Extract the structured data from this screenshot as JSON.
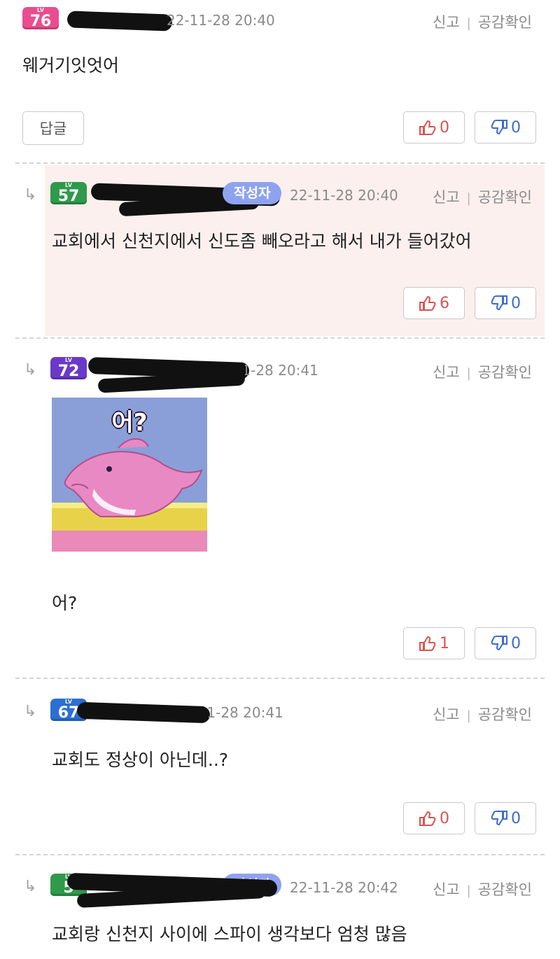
{
  "comments": [
    {
      "level": "76",
      "date": "22-11-28 20:40",
      "report_label": "신고",
      "check_label": "공감확인",
      "text": "웨거기잇엇어",
      "reply_label": "답글",
      "likes": "0",
      "dislikes": "0",
      "badge_color": "#ea4d8f"
    },
    {
      "level": "57",
      "author_tag": "작성자",
      "date": "22-11-28 20:40",
      "report_label": "신고",
      "check_label": "공감확인",
      "text": "교회에서 신천지에서 신도좀 빼오라고 해서 내가 들어갔어",
      "likes": "6",
      "dislikes": "0",
      "badge_color": "#2f9a4a"
    },
    {
      "level": "72",
      "date": "22-11-28 20:41",
      "report_label": "신고",
      "check_label": "공감확인",
      "sticker_text": "어?",
      "text": "어?",
      "likes": "1",
      "dislikes": "0",
      "badge_color": "#6a39c9"
    },
    {
      "level": "67",
      "date": "22-11-28 20:41",
      "report_label": "신고",
      "check_label": "공감확인",
      "text": "교회도 정상이 아닌데..?",
      "likes": "0",
      "dislikes": "0",
      "badge_color": "#2b6fd1"
    },
    {
      "level": "5",
      "author_tag": "작성자",
      "date": "22-11-28 20:42",
      "report_label": "신고",
      "check_label": "공감확인",
      "text": "교회랑 신천지 사이에 스파이 생각보다 엄청 많음",
      "badge_color": "#2f9a4a"
    }
  ],
  "icons": {
    "reply_arrow": "↳",
    "thumb_up": "thumb-up-icon",
    "thumb_down": "thumb-down-icon"
  }
}
